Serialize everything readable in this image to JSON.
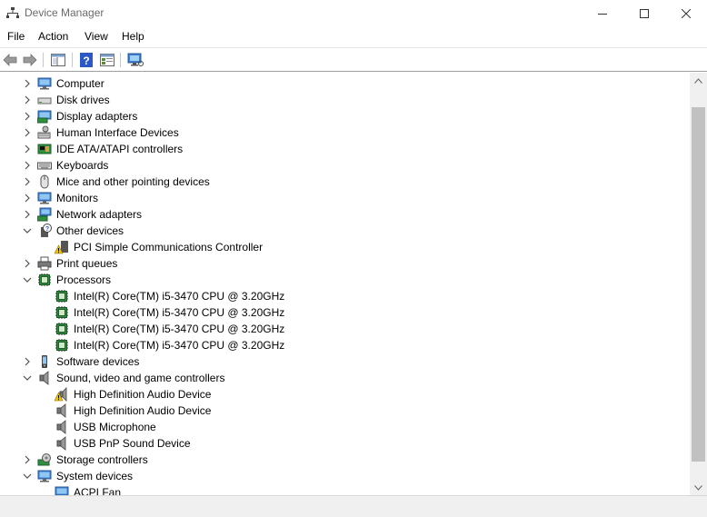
{
  "window": {
    "title": "Device Manager",
    "controls": {
      "minimize": "—",
      "maximize": "☐",
      "close": "✕"
    }
  },
  "menu": [
    "File",
    "Action",
    "View",
    "Help"
  ],
  "toolbar": [
    {
      "icon": "back-arrow-icon"
    },
    {
      "icon": "forward-arrow-icon"
    },
    {
      "icon": "show-hide-console-tree-icon"
    },
    {
      "icon": "help-icon"
    },
    {
      "icon": "properties-view-icon"
    },
    {
      "icon": "scan-hardware-monitor-icon"
    }
  ],
  "tree": [
    {
      "label": "Computer",
      "icon": "computer-icon",
      "expander": "collapsed",
      "level": 0
    },
    {
      "label": "Disk drives",
      "icon": "disk-drive-icon",
      "expander": "collapsed",
      "level": 0
    },
    {
      "label": "Display adapters",
      "icon": "display-adapter-icon",
      "expander": "collapsed",
      "level": 0
    },
    {
      "label": "Human Interface Devices",
      "icon": "hid-icon",
      "expander": "collapsed",
      "level": 0
    },
    {
      "label": "IDE ATA/ATAPI controllers",
      "icon": "ide-controller-icon",
      "expander": "collapsed",
      "level": 0
    },
    {
      "label": "Keyboards",
      "icon": "keyboard-icon",
      "expander": "collapsed",
      "level": 0
    },
    {
      "label": "Mice and other pointing devices",
      "icon": "mouse-icon",
      "expander": "collapsed",
      "level": 0
    },
    {
      "label": "Monitors",
      "icon": "monitor-icon",
      "expander": "collapsed",
      "level": 0
    },
    {
      "label": "Network adapters",
      "icon": "network-adapter-icon",
      "expander": "collapsed",
      "level": 0
    },
    {
      "label": "Other devices",
      "icon": "unknown-device-icon",
      "expander": "expanded",
      "level": 0
    },
    {
      "label": "PCI Simple Communications Controller",
      "icon": "warning-device-icon",
      "expander": "none",
      "level": 1
    },
    {
      "label": "Print queues",
      "icon": "printer-icon",
      "expander": "collapsed",
      "level": 0
    },
    {
      "label": "Processors",
      "icon": "processor-icon",
      "expander": "expanded",
      "level": 0
    },
    {
      "label": "Intel(R) Core(TM) i5-3470 CPU @ 3.20GHz",
      "icon": "processor-icon",
      "expander": "none",
      "level": 1
    },
    {
      "label": "Intel(R) Core(TM) i5-3470 CPU @ 3.20GHz",
      "icon": "processor-icon",
      "expander": "none",
      "level": 1
    },
    {
      "label": "Intel(R) Core(TM) i5-3470 CPU @ 3.20GHz",
      "icon": "processor-icon",
      "expander": "none",
      "level": 1
    },
    {
      "label": "Intel(R) Core(TM) i5-3470 CPU @ 3.20GHz",
      "icon": "processor-icon",
      "expander": "none",
      "level": 1
    },
    {
      "label": "Software devices",
      "icon": "software-device-icon",
      "expander": "collapsed",
      "level": 0
    },
    {
      "label": "Sound, video and game controllers",
      "icon": "speaker-icon",
      "expander": "expanded",
      "level": 0
    },
    {
      "label": "High Definition Audio Device",
      "icon": "speaker-warning-icon",
      "expander": "none",
      "level": 1
    },
    {
      "label": "High Definition Audio Device",
      "icon": "speaker-icon",
      "expander": "none",
      "level": 1
    },
    {
      "label": "USB Microphone",
      "icon": "speaker-icon",
      "expander": "none",
      "level": 1
    },
    {
      "label": "USB PnP Sound Device",
      "icon": "speaker-icon",
      "expander": "none",
      "level": 1
    },
    {
      "label": "Storage controllers",
      "icon": "storage-controller-icon",
      "expander": "collapsed",
      "level": 0
    },
    {
      "label": "System devices",
      "icon": "system-device-icon",
      "expander": "expanded",
      "level": 0
    },
    {
      "label": "ACPI Fan",
      "icon": "system-device-icon",
      "expander": "none",
      "level": 1
    }
  ],
  "colors": {
    "window_bg": "#ffffff",
    "scrollbar_track": "#f0f0f0",
    "scrollbar_thumb": "#c1c1c1",
    "title_text": "#6a6a6a"
  }
}
